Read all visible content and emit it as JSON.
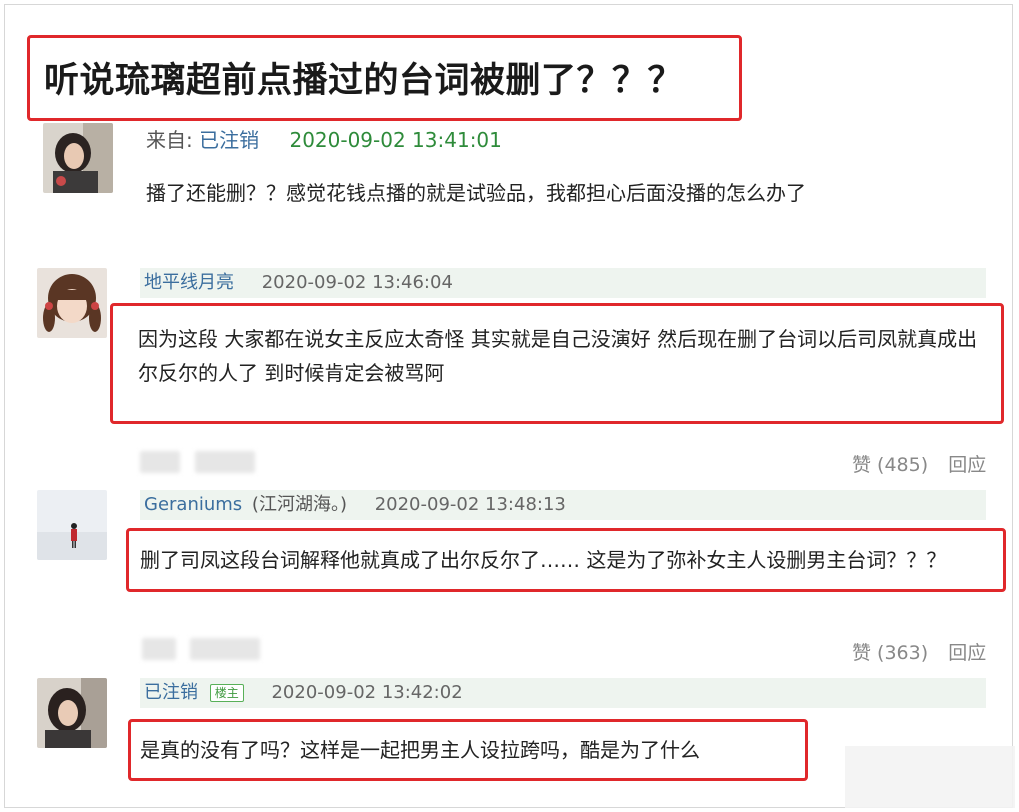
{
  "post": {
    "title": "听说琉璃超前点播过的台词被删了？？？",
    "from_label": "来自:",
    "author": "已注销",
    "time": "2020-09-02 13:41:01",
    "body": "播了还能删？？感觉花钱点播的就是试验品，我都担心后面没播的怎么办了"
  },
  "replies": [
    {
      "user": "地平线月亮",
      "time": "2020-09-02 13:46:04",
      "text": "因为这段 大家都在说女主反应太奇怪 其实就是自己没演好 然后现在删了台词以后司凤就真成出尔反尔的人了 到时候肯定会被骂阿",
      "likes": "赞 (485)",
      "reply": "回应"
    },
    {
      "user": "Geraniums",
      "user_note": "(江河湖海。)",
      "time": "2020-09-02 13:48:13",
      "text": "删了司凤这段台词解释他就真成了出尔反尔了…… 这是为了弥补女主人设删男主台词？？？",
      "likes": "赞 (363)",
      "reply": "回应"
    },
    {
      "user": "已注销",
      "owner_tag": "楼主",
      "time": "2020-09-02 13:42:02",
      "text": "是真的没有了吗？这样是一起把男主人设拉跨吗，酷是为了什么"
    }
  ],
  "colors": {
    "highlight_red": "#e0282b",
    "user_blue": "#3b6e9e",
    "time_green": "#2e8b3a",
    "meta_bg": "#eef4ef"
  }
}
